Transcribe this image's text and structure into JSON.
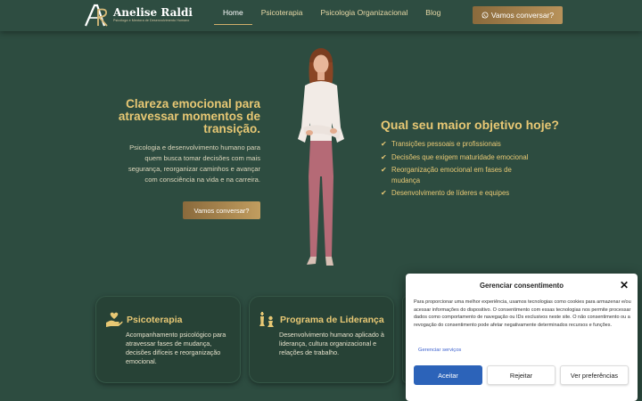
{
  "header": {
    "logo_name": "Anelise Raldi",
    "logo_sub": "Psicóloga e Mentora de Desenvolvimento Humano",
    "nav": [
      "Home",
      "Psicoterapia",
      "Psicologia Organizacional",
      "Blog"
    ],
    "active_nav": "Home",
    "cta": "Vamos conversar?",
    "cta_icon": "whatsapp-icon"
  },
  "hero": {
    "title": "Clareza emocional para atravessar momentos de transição.",
    "description": "Psicologia e desenvolvimento humano para quem busca tomar decisões com mais segurança, reorganizar caminhos e avançar com consciência na vida e na carreira.",
    "button": "Vamos conversar?"
  },
  "objectives": {
    "title": "Qual seu maior objetivo hoje?",
    "items": [
      "Transições pessoais e profissionais",
      "Decisões que exigem maturidade emocional",
      "Reorganização emocional em fases de mudança",
      "Desenvolvimento de líderes e equipes"
    ]
  },
  "cards": [
    {
      "title": "Psicoterapia",
      "icon": "hand-heart-icon",
      "description": "Acompanhamento psicológico para atravessar fases de mudança, decisões difíceis e reorganização emocional."
    },
    {
      "title": "Programa de Liderança",
      "icon": "chess-pieces-icon",
      "description": "Desenvolvimento humano aplicado à liderança, cultura organizacional e relações de trabalho."
    }
  ],
  "consent": {
    "title": "Gerenciar consentimento",
    "text": "Para proporcionar uma melhor experiência, usamos tecnologias como cookies para armazenar e/ou acessar informações do dispositivo. O consentimento com essas tecnologias nos permite processar dados como comportamento de navegação ou IDs exclusivos neste site. O não consentimento ou a revogação do consentimento pode afetar negativamente determinados recursos e funções.",
    "link": "Gerenciar serviços",
    "accept": "Aceitar",
    "reject": "Rejeitar",
    "preferences": "Ver preferências"
  },
  "colors": {
    "background": "#2d4c40",
    "gold": "#e8c874",
    "button_bronze": "#a8834d",
    "consent_primary": "#2c63b9"
  }
}
